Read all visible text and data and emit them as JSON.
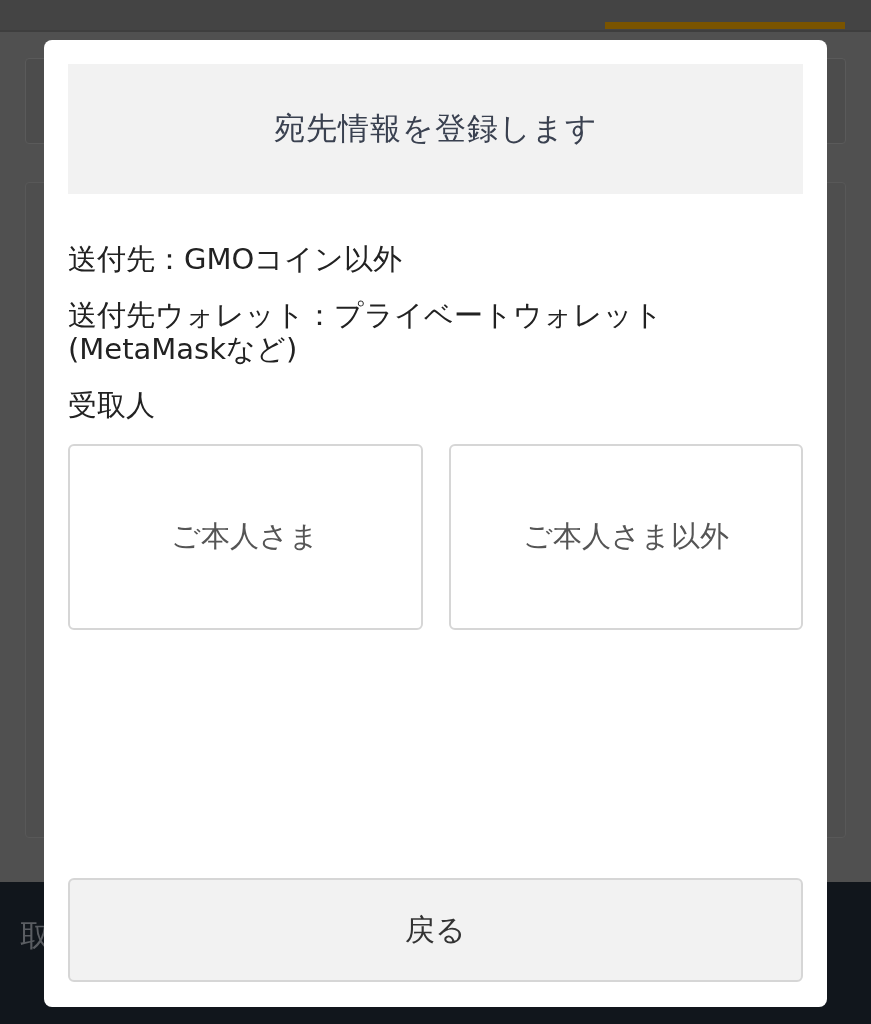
{
  "background": {
    "tab_indicator": {
      "selected": true
    },
    "bottom_bar": {
      "label": "取"
    }
  },
  "dialog": {
    "title": "宛先情報を登録します",
    "details": [
      "送付先：GMOコイン以外",
      "送付先ウォレット：プライベートウォレット(MetaMaskなど)"
    ],
    "recipient_label": "受取人",
    "options": [
      {
        "label": "ご本人さま",
        "selected": false
      },
      {
        "label": "ご本人さま以外",
        "selected": false
      }
    ],
    "back_button": "戻る"
  }
}
